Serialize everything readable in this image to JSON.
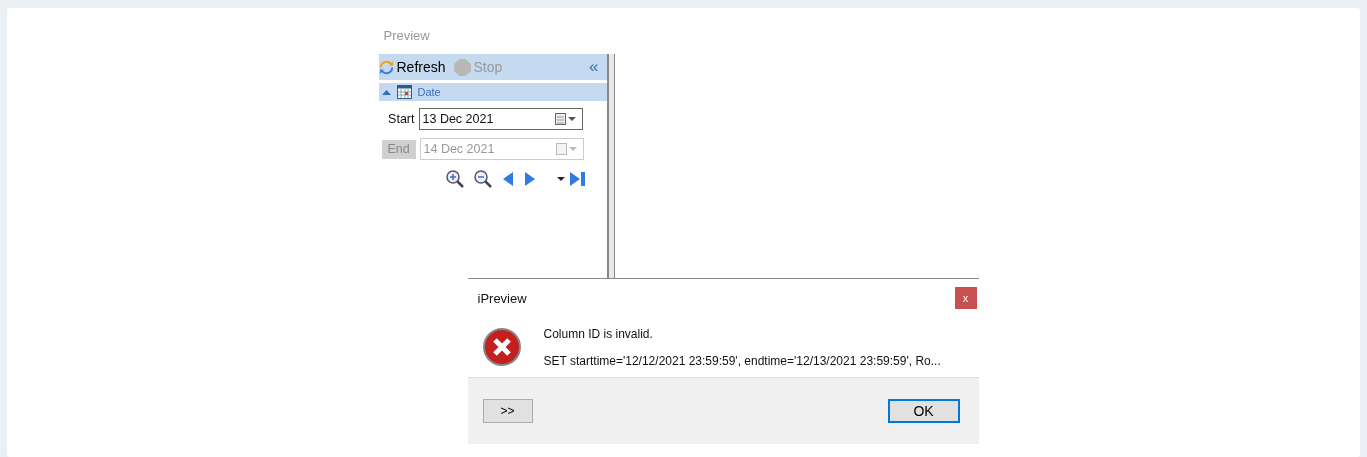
{
  "panel": {
    "title": "Preview"
  },
  "toolbar": {
    "refresh": {
      "label": "Refresh",
      "disabled": false
    },
    "stop": {
      "label": "Stop",
      "disabled": true
    },
    "collapse": "«"
  },
  "date_group": {
    "label": "Date",
    "expanded": true
  },
  "start": {
    "label": "Start",
    "value": "13 Dec 2021",
    "disabled": false
  },
  "end": {
    "label": "End",
    "value": "14 Dec 2021",
    "disabled": true
  },
  "dialog": {
    "title": "iPreview",
    "close": "x",
    "message": "Column ID is invalid.",
    "detail": "SET starttime='12/12/2021 23:59:59', endtime='12/13/2021 23:59:59', Ro...",
    "details_button": ">>",
    "ok_button": {
      "label": "OK",
      "focused": true
    }
  }
}
